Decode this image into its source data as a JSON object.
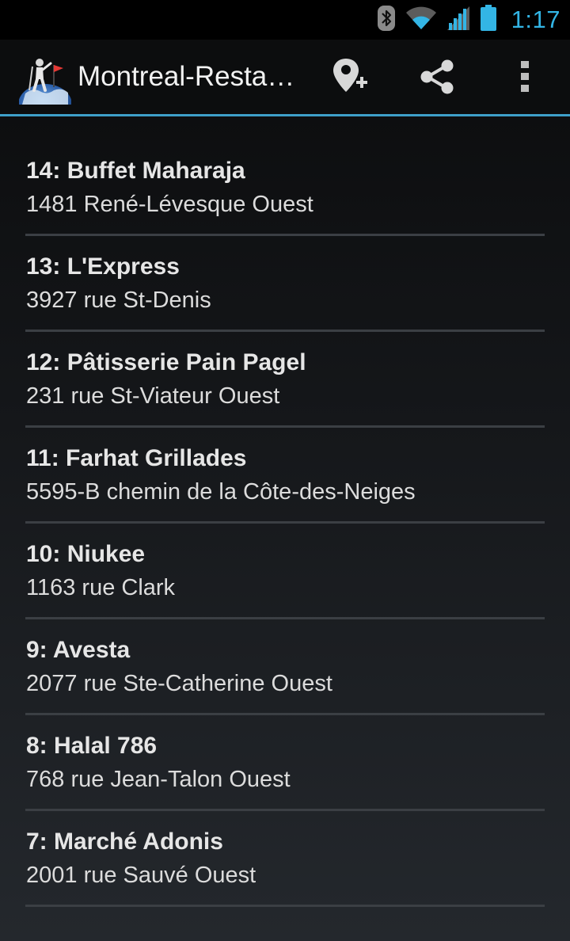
{
  "status_bar": {
    "time": "1:17",
    "icons": [
      "bluetooth-icon",
      "wifi-icon",
      "cell-signal-icon",
      "battery-icon"
    ],
    "accent_color": "#33b5e5"
  },
  "action_bar": {
    "title": "Montreal-Resta…",
    "actions": [
      "add-place-icon",
      "share-icon",
      "overflow-menu-icon"
    ],
    "divider_color": "#3e9fc9"
  },
  "items": [
    {
      "title": "14: Buffet Maharaja",
      "address": "1481 René-Lévesque Ouest"
    },
    {
      "title": "13: L'Express",
      "address": "3927 rue St-Denis"
    },
    {
      "title": "12: Pâtisserie Pain Pagel",
      "address": "231 rue St-Viateur Ouest"
    },
    {
      "title": "11: Farhat Grillades",
      "address": "5595-B chemin de la Côte-des-Neiges"
    },
    {
      "title": "10: Niukee",
      "address": "1163 rue Clark"
    },
    {
      "title": "9: Avesta",
      "address": "2077 rue Ste-Catherine Ouest"
    },
    {
      "title": "8: Halal 786",
      "address": "768 rue Jean-Talon Ouest"
    },
    {
      "title": "7: Marché Adonis",
      "address": "2001 rue Sauvé Ouest"
    }
  ]
}
